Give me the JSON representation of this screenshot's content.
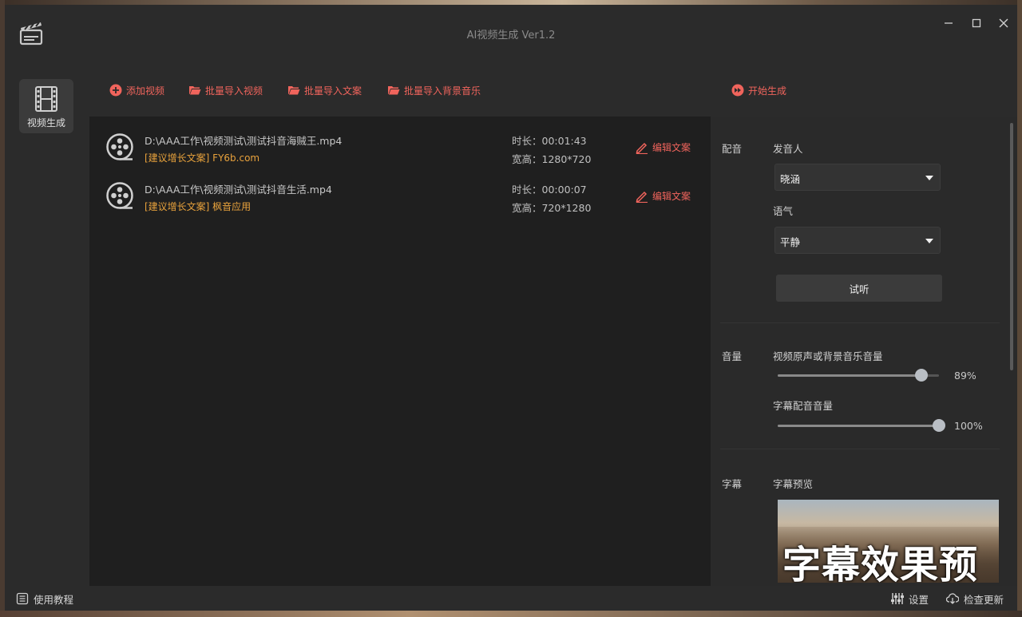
{
  "window": {
    "title": "AI视频生成 Ver1.2"
  },
  "sidebar": {
    "items": [
      {
        "label": "视频生成",
        "icon": "film-icon",
        "active": true
      }
    ]
  },
  "toolbar": {
    "add_video": "添加视频",
    "batch_import_video": "批量导入视频",
    "batch_import_copy": "批量导入文案",
    "batch_import_music": "批量导入背景音乐",
    "start_generate": "开始生成"
  },
  "videos": [
    {
      "path": "D:\\AAA工作\\视频测试\\测试抖音海贼王.mp4",
      "tip": "[建议增长文案] FY6b.com",
      "duration": "时长：00:01:43",
      "resolution": "宽高：1280*720",
      "edit_label": "编辑文案"
    },
    {
      "path": "D:\\AAA工作\\视频测试\\测试抖音生活.mp4",
      "tip": "[建议增长文案] 枫音应用",
      "duration": "时长：00:00:07",
      "resolution": "宽高：720*1280",
      "edit_label": "编辑文案"
    }
  ],
  "dubbing": {
    "section_label": "配音",
    "speaker_label": "发音人",
    "speaker_value": "晓涵",
    "tone_label": "语气",
    "tone_value": "平静",
    "listen_button": "试听"
  },
  "volume": {
    "section_label": "音量",
    "bg_label": "视频原声或背景音乐音量",
    "bg_value": 0.89,
    "bg_pct": "89%",
    "sub_label": "字幕配音音量",
    "sub_value": 1.0,
    "sub_pct": "100%"
  },
  "subtitle": {
    "section_label": "字幕",
    "preview_label": "字幕预览",
    "preview_text": "字幕效果预"
  },
  "statusbar": {
    "tutorial": "使用教程",
    "settings": "设置",
    "check_update": "检查更新"
  },
  "colors": {
    "accent": "#f0645c",
    "tip": "#e8a23c",
    "background": "#2a2a2a",
    "list_background": "#1f1f1f"
  }
}
